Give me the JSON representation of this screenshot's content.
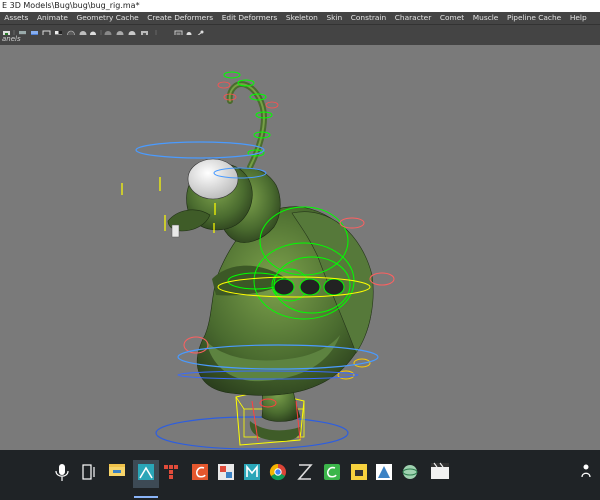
{
  "window": {
    "title": "E 3D Models\\Bug\\bug\\bug_rig.ma*"
  },
  "menubar": {
    "items": [
      "Assets",
      "Animate",
      "Geometry Cache",
      "Create Deformers",
      "Edit Deformers",
      "Skeleton",
      "Skin",
      "Constrain",
      "Character",
      "Comet",
      "Muscle",
      "Pipeline Cache",
      "Help"
    ]
  },
  "panels": {
    "label": "anels"
  },
  "toolbar": {
    "icons": [
      "toggle-icon",
      "grid-icon",
      "cube-icon",
      "cube-outline-icon",
      "checker-icon",
      "sphere-dark-icon",
      "sphere-light-icon",
      "light-icon",
      "shadow-icon",
      "camera-icon",
      "screen-icon",
      "xray-icon",
      "joint-icon",
      "transform-icon"
    ]
  },
  "viewport": {
    "background": "#7a7a7a",
    "mesh_color": "#4a6b2f",
    "control_green": "#00ff00",
    "control_yellow": "#ffff00",
    "control_blue": "#3a6bff",
    "control_red": "#ff4040"
  },
  "taskbar": {
    "apps": [
      "microphone-icon",
      "taskview-icon",
      "file-explorer-icon",
      "maya-icon",
      "grid-app-icon",
      "comet-app-icon",
      "image-app-icon",
      "maya-m-icon",
      "chrome-icon",
      "zbrush-icon",
      "camtasia-icon",
      "sticky-notes-icon",
      "blender-icon",
      "clapper-icon"
    ],
    "tray": "ጸ"
  }
}
